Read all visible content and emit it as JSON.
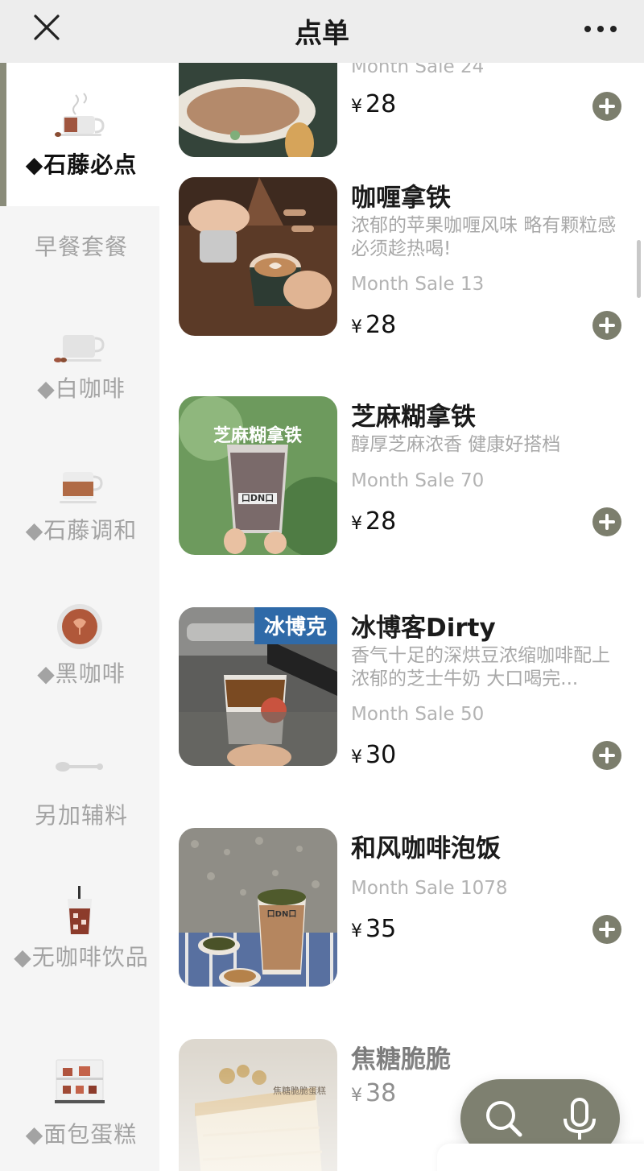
{
  "header": {
    "title": "点单",
    "close_icon": "close-icon",
    "more_icon": "more-icon"
  },
  "sidebar": {
    "items": [
      {
        "label": "◆石藤必点",
        "icon": "hot-coffee-cup-icon",
        "active": true
      },
      {
        "label": "早餐套餐",
        "icon": "",
        "active": false
      },
      {
        "label": "◆白咖啡",
        "icon": "white-coffee-cup-icon",
        "active": false
      },
      {
        "label": "◆石藤调和",
        "icon": "latte-cup-icon",
        "active": false
      },
      {
        "label": "◆黑咖啡",
        "icon": "black-coffee-icon",
        "active": false
      },
      {
        "label": "另加辅料",
        "icon": "spoon-icon",
        "active": false
      },
      {
        "label": "◆无咖啡饮品",
        "icon": "iced-drink-icon",
        "active": false
      },
      {
        "label": "◆面包蛋糕",
        "icon": "cake-display-icon",
        "active": false
      }
    ]
  },
  "products": [
    {
      "name": "",
      "desc": "",
      "sale": "Month Sale 24",
      "currency": "¥",
      "price": "28"
    },
    {
      "name": "咖喱拿铁",
      "desc": "浓郁的苹果咖喱风味 略有颗粒感 必须趁热喝!",
      "sale": "Month Sale 13",
      "currency": "¥",
      "price": "28"
    },
    {
      "name": "芝麻糊拿铁",
      "desc": "醇厚芝麻浓香 健康好搭档",
      "sale": "Month Sale 70",
      "currency": "¥",
      "price": "28"
    },
    {
      "name": "冰博客Dirty",
      "desc": "香气十足的深烘豆浓缩咖啡配上浓郁的芝士牛奶 大口喝完...",
      "sale": "Month Sale 50",
      "currency": "¥",
      "price": "30"
    },
    {
      "name": "和风咖啡泡饭",
      "desc": "",
      "sale": "Month Sale 1078",
      "currency": "¥",
      "price": "35"
    },
    {
      "name": "焦糖脆脆",
      "desc": "",
      "sale": "",
      "currency": "¥",
      "price": "38"
    }
  ],
  "thumb_text": {
    "sesame": "芝麻糊拿铁",
    "bingboke": "冰博克",
    "cup_brand": "口DN口",
    "caramel": "焦糖脆脆蛋糕"
  },
  "floating": {
    "search_icon": "search-icon",
    "mic_icon": "microphone-icon"
  },
  "colors": {
    "accent": "#7c7e6d",
    "sidebar_bg": "#f5f5f5",
    "header_bg": "#ededed"
  }
}
